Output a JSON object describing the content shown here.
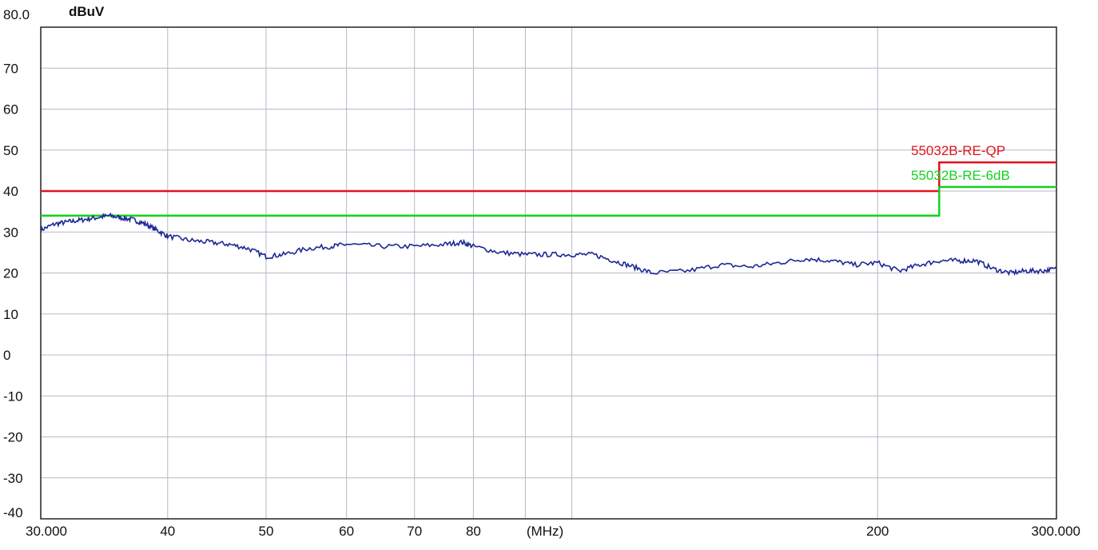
{
  "chart_data": {
    "type": "line",
    "title": "",
    "ylabel": "dBuV",
    "xlabel": "(MHz)",
    "xscale": "log",
    "xlim": [
      30,
      300
    ],
    "ylim": [
      -40,
      80
    ],
    "grid": true,
    "y_ticks": [
      {
        "value": 80,
        "label": "80.0"
      },
      {
        "value": 70,
        "label": "70"
      },
      {
        "value": 60,
        "label": "60"
      },
      {
        "value": 50,
        "label": "50"
      },
      {
        "value": 40,
        "label": "40"
      },
      {
        "value": 30,
        "label": "30"
      },
      {
        "value": 20,
        "label": "20"
      },
      {
        "value": 10,
        "label": "10"
      },
      {
        "value": 0,
        "label": "0"
      },
      {
        "value": -10,
        "label": "-10"
      },
      {
        "value": -20,
        "label": "-20"
      },
      {
        "value": -30,
        "label": "-30"
      },
      {
        "value": -40,
        "label": "-40"
      }
    ],
    "x_ticks": [
      {
        "value": 30,
        "label": "30.000"
      },
      {
        "value": 40,
        "label": "40"
      },
      {
        "value": 50,
        "label": "50"
      },
      {
        "value": 60,
        "label": "60"
      },
      {
        "value": 70,
        "label": "70"
      },
      {
        "value": 80,
        "label": "80"
      },
      {
        "value": 200,
        "label": "200"
      },
      {
        "value": 300,
        "label": "300.000"
      }
    ],
    "x_grid": [
      30,
      40,
      50,
      60,
      70,
      80,
      90,
      100,
      200,
      300
    ],
    "limits": [
      {
        "name": "55032B-RE-QP",
        "color": "#e0141c",
        "points": [
          [
            30,
            40
          ],
          [
            230,
            40
          ],
          [
            230,
            47
          ],
          [
            300,
            47
          ]
        ]
      },
      {
        "name": "55032B-RE-6dB",
        "color": "#14d21e",
        "points": [
          [
            30,
            34
          ],
          [
            230,
            34
          ],
          [
            230,
            41
          ],
          [
            300,
            41
          ]
        ]
      }
    ],
    "series": [
      {
        "color": "#1e2896",
        "x": [
          30,
          31,
          32,
          33,
          34,
          35,
          36,
          37,
          38,
          39,
          40,
          42,
          44,
          46,
          48,
          50,
          52,
          55,
          58,
          60,
          65,
          70,
          75,
          78,
          80,
          85,
          90,
          95,
          100,
          105,
          110,
          115,
          120,
          130,
          140,
          150,
          160,
          170,
          180,
          190,
          200,
          210,
          220,
          230,
          240,
          250,
          260,
          270,
          280,
          290,
          300
        ],
        "y": [
          30.5,
          32,
          32.5,
          33,
          33.5,
          34,
          33.5,
          33,
          32,
          30.5,
          29,
          28,
          27.5,
          27,
          26,
          24,
          24.5,
          26,
          26.5,
          27,
          26.5,
          26.5,
          27,
          27.5,
          26.5,
          25,
          24.5,
          24.5,
          24.5,
          24.5,
          23,
          21.5,
          20,
          20.5,
          22,
          21.5,
          22.5,
          23.5,
          23,
          22,
          22.5,
          20.5,
          22,
          23,
          23,
          23,
          21,
          20,
          20.5,
          20.5,
          21
        ]
      }
    ]
  }
}
